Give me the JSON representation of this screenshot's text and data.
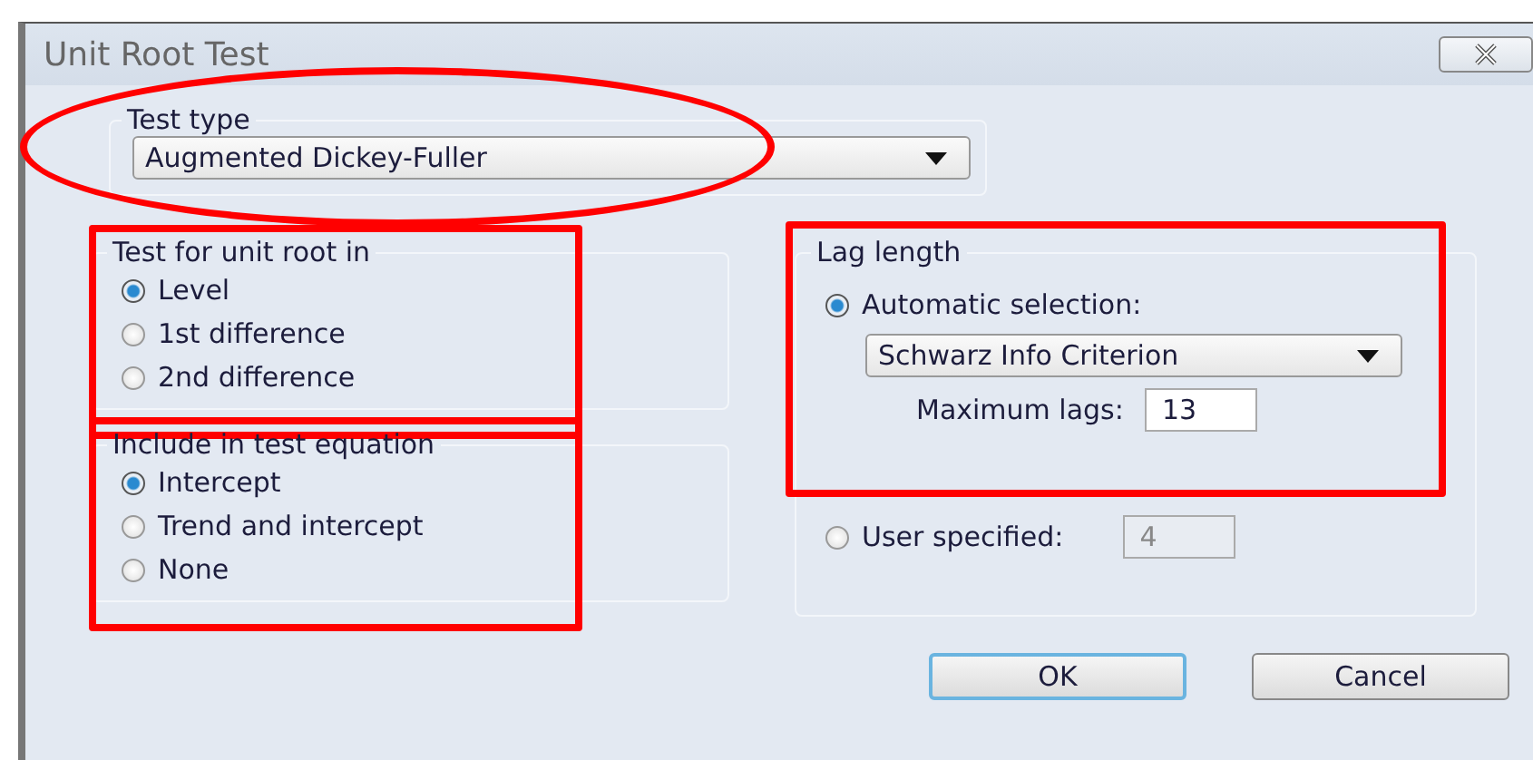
{
  "window": {
    "title": "Unit Root Test"
  },
  "test_type": {
    "label": "Test type",
    "value": "Augmented Dickey-Fuller",
    "highlighted": true
  },
  "unit_root_in": {
    "label": "Test for unit root in",
    "highlighted": true,
    "options": [
      {
        "label": "Level",
        "selected": true
      },
      {
        "label": "1st difference",
        "selected": false
      },
      {
        "label": "2nd difference",
        "selected": false
      }
    ]
  },
  "test_equation": {
    "label": "Include in test equation",
    "highlighted": true,
    "options": [
      {
        "label": "Intercept",
        "selected": true
      },
      {
        "label": "Trend and intercept",
        "selected": false
      },
      {
        "label": "None",
        "selected": false
      }
    ]
  },
  "lag_length": {
    "label": "Lag length",
    "highlighted": true,
    "automatic": {
      "label": "Automatic selection:",
      "selected": true,
      "criterion": "Schwarz Info Criterion",
      "max_lags_label": "Maximum lags:",
      "max_lags": "13"
    },
    "user": {
      "label": "User specified:",
      "selected": false,
      "value": "4",
      "disabled": true
    }
  },
  "buttons": [
    {
      "label": "OK",
      "default": true
    },
    {
      "label": "Cancel",
      "default": false
    }
  ]
}
